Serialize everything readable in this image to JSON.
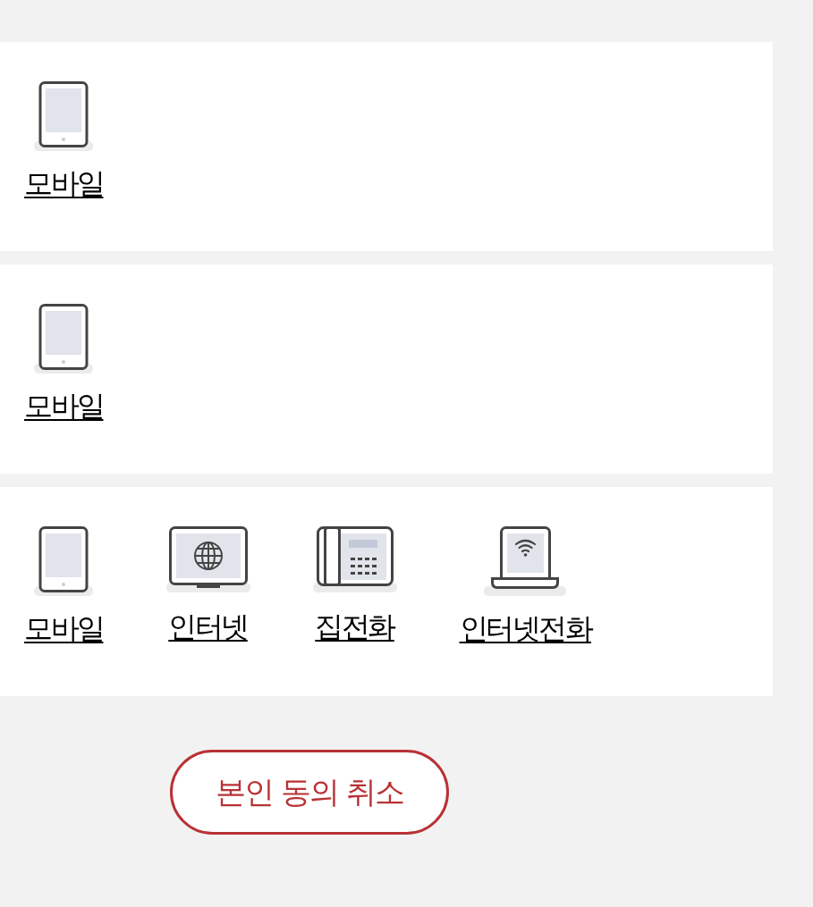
{
  "sections": [
    {
      "services": [
        {
          "kind": "mobile",
          "label": "모바일"
        }
      ]
    },
    {
      "services": [
        {
          "kind": "mobile",
          "label": "모바일"
        }
      ]
    },
    {
      "services": [
        {
          "kind": "mobile",
          "label": "모바일"
        },
        {
          "kind": "internet",
          "label": "인터넷"
        },
        {
          "kind": "home_phone",
          "label": "집전화"
        },
        {
          "kind": "internet_phone",
          "label": "인터넷전화"
        }
      ]
    }
  ],
  "cancel_button": {
    "label": "본인 동의 취소"
  }
}
